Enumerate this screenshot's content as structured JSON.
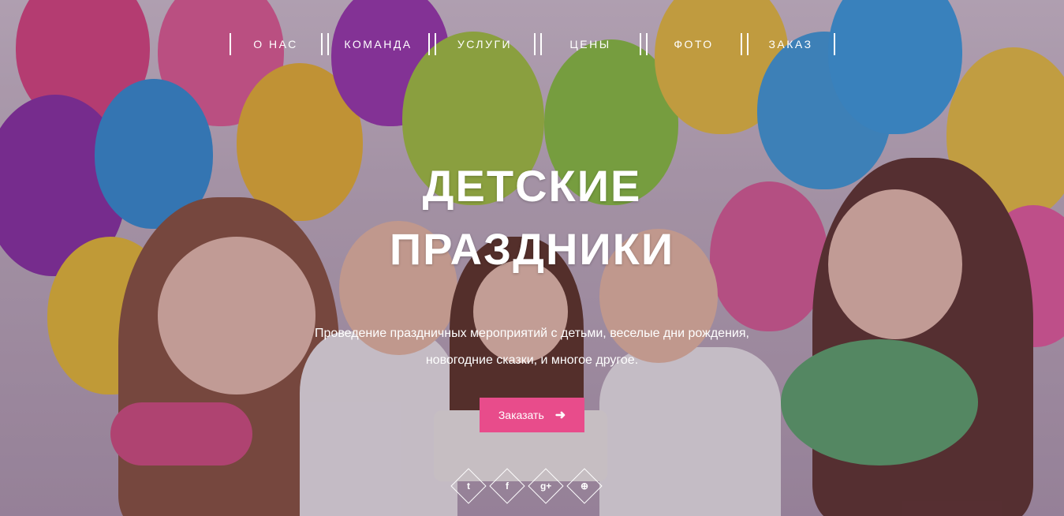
{
  "nav": {
    "items": [
      {
        "label": "О НАС"
      },
      {
        "label": "КОМАНДА"
      },
      {
        "label": "УСЛУГИ"
      },
      {
        "label": "ЦЕНЫ"
      },
      {
        "label": "ФОТО"
      },
      {
        "label": "ЗАКАЗ"
      }
    ]
  },
  "hero": {
    "title_line1": "ДЕТСКИЕ",
    "title_line2": "ПРАЗДНИКИ",
    "subtitle_line1": "Проведение праздничных мероприятий с детьми, веселые дни рождения,",
    "subtitle_line2": "новогодние сказки, и многое другое.",
    "cta_label": "Заказать",
    "cta_icon": "arrow-right-icon"
  },
  "social": {
    "icons": [
      "twitter-icon",
      "facebook-icon",
      "google-plus-icon",
      "dribbble-icon"
    ],
    "glyphs": [
      "t",
      "f",
      "g+",
      "⊕"
    ]
  },
  "colors": {
    "accent": "#e84c8b",
    "text": "#ffffff"
  }
}
